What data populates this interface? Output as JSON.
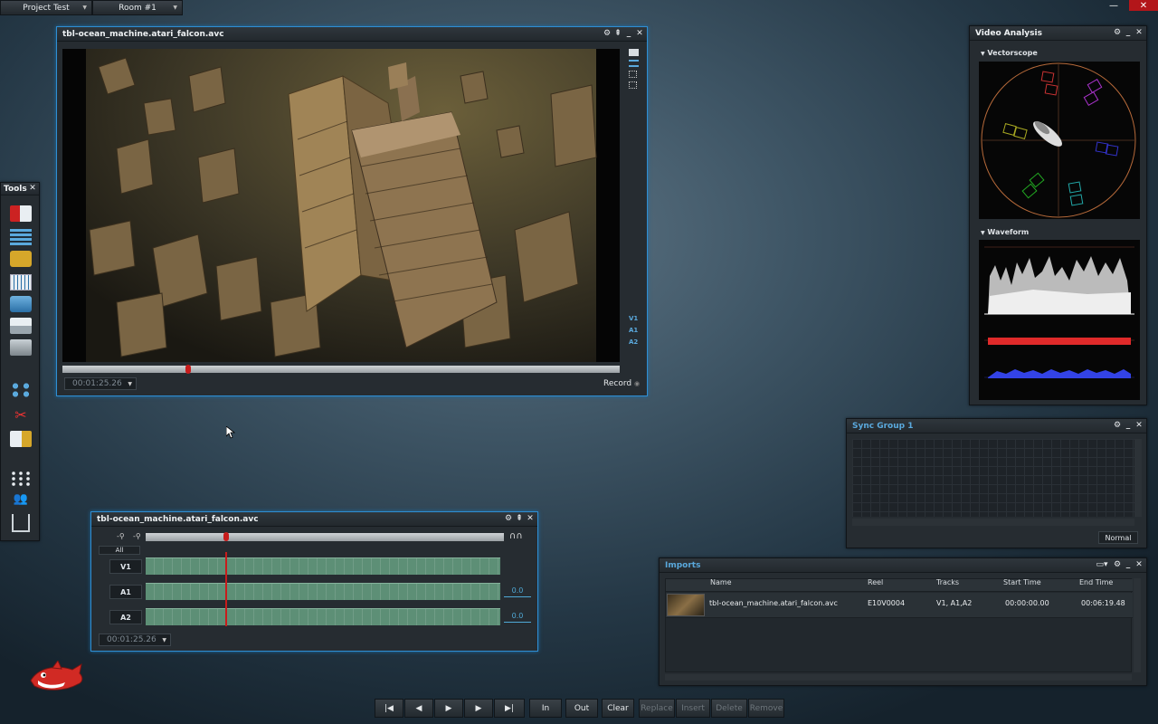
{
  "topbar": {
    "project": "Project Test",
    "room": "Room #1"
  },
  "viewer": {
    "title": "tbl-ocean_machine.atari_falcon.avc",
    "timecode": "00:01:25.26",
    "record_label": "Record",
    "tracks": [
      "V1",
      "A1",
      "A2"
    ],
    "playhead_fraction": 0.225
  },
  "tools": {
    "title": "Tools",
    "icons": [
      "import-icon",
      "list-icon",
      "archive-icon",
      "grid-icon",
      "stack-icon",
      "printer-icon",
      "drive-icon",
      "calculator-icon",
      "scissors-icon",
      "export-icon",
      "apps-icon",
      "users-icon",
      "download-icon"
    ]
  },
  "video_analysis": {
    "title": "Video Analysis",
    "vectorscope_label": "Vectorscope",
    "waveform_label": "Waveform"
  },
  "sync_group": {
    "title": "Sync Group 1",
    "mode": "Normal"
  },
  "timeline": {
    "title": "tbl-ocean_machine.atari_falcon.avc",
    "all_label": "All",
    "timecode": "00:01:25.26",
    "tracks": [
      {
        "name": "V1",
        "level": ""
      },
      {
        "name": "A1",
        "level": "0.0"
      },
      {
        "name": "A2",
        "level": "0.0"
      }
    ],
    "playhead_fraction": 0.225
  },
  "imports": {
    "title": "Imports",
    "columns": [
      "Name",
      "Reel",
      "Tracks",
      "Start Time",
      "End Time"
    ],
    "rows": [
      {
        "name": "tbl-ocean_machine.atari_falcon.avc",
        "reel": "E10V0004",
        "tracks": "V1, A1,A2",
        "start": "00:00:00.00",
        "end": "00:06:19.48"
      }
    ]
  },
  "transport": {
    "buttons": [
      "In",
      "Out",
      "Clear",
      "Replace",
      "Insert",
      "Delete",
      "Remove"
    ]
  },
  "colors": {
    "accent": "#2f8ed3",
    "clip": "#5d8f76",
    "playhead": "#c81c1c"
  }
}
